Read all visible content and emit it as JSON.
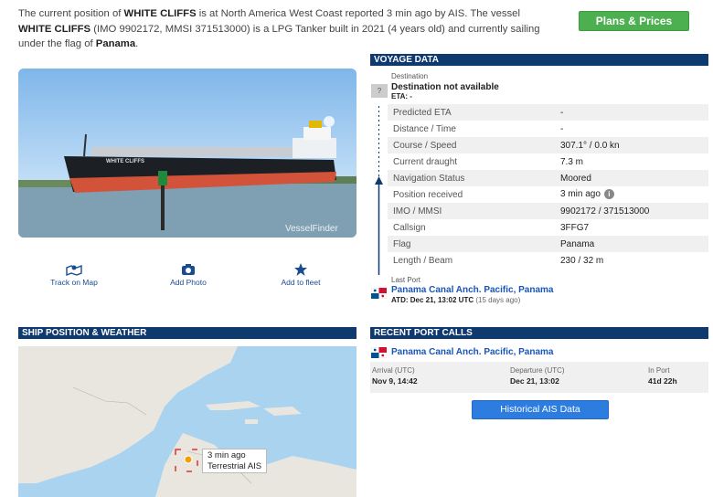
{
  "intro": {
    "t1": "The current position of ",
    "name1": "WHITE CLIFFS",
    "t2": " is at North America West Coast reported 3 min ago by AIS. The vessel ",
    "name2": "WHITE CLIFFS",
    "t3": " (IMO 9902172, MMSI 371513000) is a LPG Tanker built in 2021 (4 years old) and currently sailing under the flag of ",
    "flag": "Panama",
    "t4": "."
  },
  "plans_button": "Plans & Prices",
  "photo": {
    "ship_name": "WHITE CLIFFS",
    "watermark": "VesselFinder"
  },
  "actions": [
    {
      "label": "Track on Map",
      "icon": "map-pin-icon"
    },
    {
      "label": "Add Photo",
      "icon": "camera-icon"
    },
    {
      "label": "Add to fleet",
      "icon": "star-icon"
    }
  ],
  "voyage": {
    "header": "VOYAGE DATA",
    "dest_label": "Destination",
    "dest_value": "Destination not available",
    "eta_line": "ETA: -",
    "rows": [
      {
        "label": "Predicted ETA",
        "value": "-"
      },
      {
        "label": "Distance / Time",
        "value": "-"
      },
      {
        "label": "Course / Speed",
        "value": "307.1° / 0.0 kn"
      },
      {
        "label": "Current draught",
        "value": "7.3 m"
      },
      {
        "label": "Navigation Status",
        "value": "Moored"
      },
      {
        "label": "Position received",
        "value": "3 min ago"
      },
      {
        "label": "IMO / MMSI",
        "value": "9902172 / 371513000"
      },
      {
        "label": "Callsign",
        "value": "3FFG7"
      },
      {
        "label": "Flag",
        "value": "Panama"
      },
      {
        "label": "Length / Beam",
        "value": "230 / 32 m"
      }
    ],
    "last_port_label": "Last Port",
    "last_port": "Panama Canal Anch. Pacific, Panama",
    "atd": "ATD: Dec 21, 13:02 UTC",
    "atd_ago": "(15 days ago)"
  },
  "ship_position": {
    "header": "SHIP POSITION & WEATHER",
    "marker_time": "3 min ago",
    "marker_source": "Terrestrial AIS"
  },
  "recent_calls": {
    "header": "RECENT PORT CALLS",
    "port": "Panama Canal Anch. Pacific, Panama",
    "arrival_label": "Arrival (UTC)",
    "arrival": "Nov 9, 14:42",
    "departure_label": "Departure (UTC)",
    "departure": "Dec 21, 13:02",
    "inport_label": "In Port",
    "inport": "41d 22h"
  },
  "historical_button": "Historical AIS Data",
  "colors": {
    "header_bg": "#0e3a70",
    "link": "#1a56b8",
    "green_btn": "#4caf50",
    "blue_btn": "#2d7de0"
  }
}
